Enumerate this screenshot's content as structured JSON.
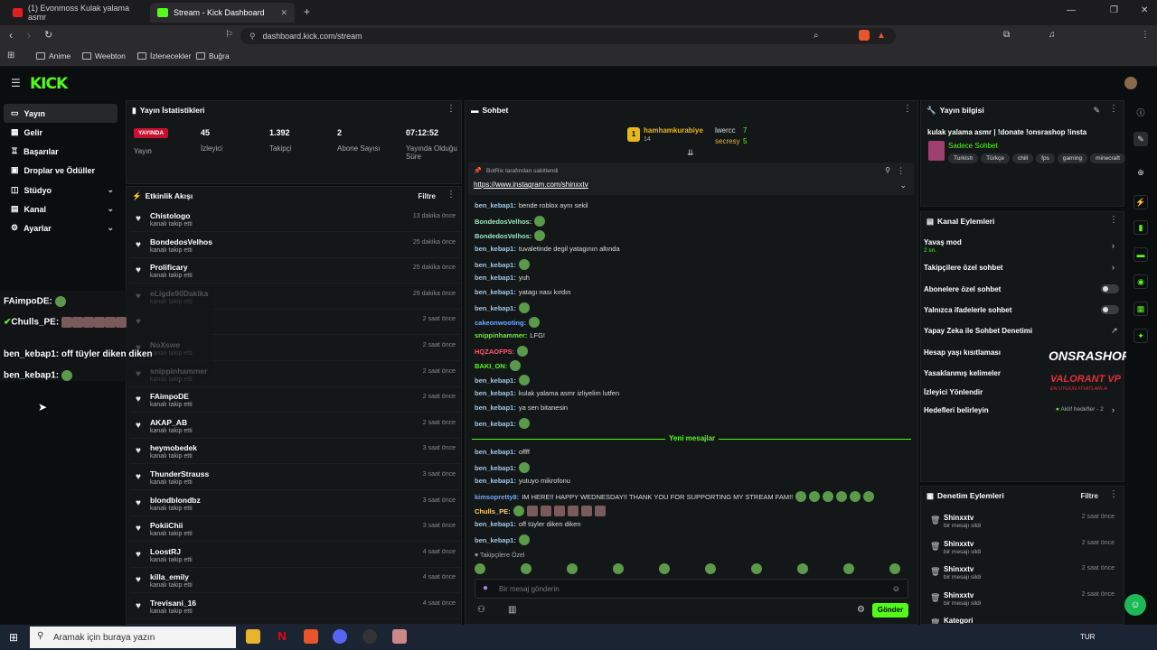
{
  "browser": {
    "tabs": [
      {
        "title": "(1) Evonmoss Kulak yalama asmr"
      },
      {
        "title": "Stream - Kick Dashboard"
      }
    ],
    "url": "dashboard.kick.com/stream",
    "bookmarks": [
      "Anime",
      "Weebton",
      "İzlenecekler",
      "Buğra"
    ]
  },
  "kick": {
    "logo": "KICK"
  },
  "sidebar": {
    "items": [
      {
        "label": "Yayın"
      },
      {
        "label": "Gelir"
      },
      {
        "label": "Başarılar"
      },
      {
        "label": "Droplar ve Ödüller"
      },
      {
        "label": "Stüdyo"
      },
      {
        "label": "Kanal"
      },
      {
        "label": "Ayarlar"
      }
    ]
  },
  "stats": {
    "title": "Yayın İstatistikleri",
    "live_badge": "YAYINDA",
    "live_label": "Yayın",
    "viewers": "45",
    "viewers_label": "İzleyici",
    "followers": "1.392",
    "followers_label": "Takipçi",
    "subs": "2",
    "subs_label": "Abone Sayısı",
    "uptime": "07:12:52",
    "uptime_label": "Yayında Olduğu Süre"
  },
  "activity": {
    "title": "Etkinlik Akışı",
    "filter": "Filtre",
    "events": [
      {
        "name": "Chistologo",
        "sub": "kanalı takip etti",
        "time": "13 dakika önce"
      },
      {
        "name": "BondedosVelhos",
        "sub": "kanalı takip etti",
        "time": "25 dakika önce"
      },
      {
        "name": "Prolificary",
        "sub": "kanalı takip etti",
        "time": "25 dakika önce"
      },
      {
        "name": "eLigde90Dakika",
        "sub": "kanalı takip etti",
        "time": "29 dakika önce"
      },
      {
        "name": "",
        "sub": "",
        "time": "2 saat önce"
      },
      {
        "name": "NoXswe",
        "sub": "kanalı takip etti",
        "time": "2 saat önce"
      },
      {
        "name": "snippinhammer",
        "sub": "kanalı takip etti",
        "time": "2 saat önce"
      },
      {
        "name": "FAimpoDE",
        "sub": "kanalı takip etti",
        "time": "2 saat önce"
      },
      {
        "name": "AKAP_AB",
        "sub": "kanalı takip etti",
        "time": "2 saat önce"
      },
      {
        "name": "heymobedek",
        "sub": "kanalı takip etti",
        "time": "3 saat önce"
      },
      {
        "name": "ThunderStrauss",
        "sub": "kanalı takip etti",
        "time": "3 saat önce"
      },
      {
        "name": "blondblondbz",
        "sub": "kanalı takip etti",
        "time": "3 saat önce"
      },
      {
        "name": "PokiiChii",
        "sub": "kanalı takip etti",
        "time": "3 saat önce"
      },
      {
        "name": "LoostRJ",
        "sub": "kanalı takip etti",
        "time": "4 saat önce"
      },
      {
        "name": "killa_emily",
        "sub": "kanalı takip etti",
        "time": "4 saat önce"
      },
      {
        "name": "Trevisani_16",
        "sub": "kanalı takip etti",
        "time": "4 saat önce"
      }
    ]
  },
  "overlay": {
    "lines": [
      {
        "user": "FAimpoDE:",
        "text": ""
      },
      {
        "user": "Chulls_PE:",
        "text": ""
      },
      {
        "user": "ben_kebap1:",
        "text": "off tüyler diken diken"
      },
      {
        "user": "ben_kebap1:",
        "text": ""
      }
    ]
  },
  "chat": {
    "title": "Sohbet",
    "top": [
      {
        "user": "hamhamkurabiye",
        "count": "14"
      },
      {
        "user": "lwercc",
        "count": "7"
      },
      {
        "user": "secresy",
        "count": "5"
      }
    ],
    "pinned_by": "BotRix tarafından sabitlendi",
    "pinned_link": "https://www.instagram.com/shinxxtv",
    "messages": [
      {
        "user": "ben_kebap1:",
        "text": "bende roblox aynı sekil"
      },
      {
        "user": "BondedosVelhos:",
        "text": ""
      },
      {
        "user": "BondedosVelhos:",
        "text": ""
      },
      {
        "user": "ben_kebap1:",
        "text": "tuvaletinde degil yatagının altında"
      },
      {
        "user": "ben_kebap1:",
        "text": ""
      },
      {
        "user": "ben_kebap1:",
        "text": "yuh"
      },
      {
        "user": "ben_kebap1:",
        "text": "yatagı nası kırdın"
      },
      {
        "user": "ben_kebap1:",
        "text": ""
      },
      {
        "user": "cakeonwooting:",
        "text": ""
      },
      {
        "user": "snippinhammer:",
        "text": "LFG!"
      },
      {
        "user": "HQZAOFPS:",
        "text": ""
      },
      {
        "user": "BAKI_ON:",
        "text": ""
      },
      {
        "user": "ben_kebap1:",
        "text": ""
      },
      {
        "user": "ben_kebap1:",
        "text": "kulak yalama asmr izliyelim lutfen"
      },
      {
        "user": "ben_kebap1:",
        "text": "ya sen bitanesin"
      },
      {
        "user": "ben_kebap1:",
        "text": ""
      }
    ],
    "new_messages": "Yeni mesajlar",
    "messages2": [
      {
        "user": "ben_kebap1:",
        "text": "offff"
      },
      {
        "user": "ben_kebap1:",
        "text": ""
      },
      {
        "user": "ben_kebap1:",
        "text": "yutuyo mikrofonu"
      },
      {
        "user": "kimsopretty8:",
        "text": "IM HERE!! HAPPY WEDNESDAY!! THANK YOU FOR SUPPORTING MY STREAM FAM!!"
      },
      {
        "user": "Chulls_PE:",
        "text": ""
      },
      {
        "user": "ben_kebap1:",
        "text": "off tüyler diken diken"
      },
      {
        "user": "ben_kebap1:",
        "text": ""
      }
    ],
    "followers_only": "Takipçilere Özel",
    "input_placeholder": "Bir mesaj gönderin",
    "send": "Gönder"
  },
  "info": {
    "title": "Yayın bilgisi",
    "stream_title": "kulak yalama asmr | !donate !onsrashop !insta",
    "category": "Sadece Sohbet",
    "tags": [
      "Turkish",
      "Türkçe",
      "chill",
      "fps",
      "gaming",
      "minecraft"
    ]
  },
  "channel": {
    "title": "Kanal Eylemleri",
    "slow_mode": "Yavaş mod",
    "slow_value": "2 sn.",
    "items": [
      "Takipçilere özel sohbet",
      "Abonelere özel sohbet",
      "Yalnızca ifadelerle sohbet",
      "Yapay Zeka ile Sohbet Denetimi",
      "Hesap yaşı kısıtlaması",
      "Yasaklanmış kelimeler",
      "İzleyici Yönlendir",
      "Hedefleri belirleyin"
    ],
    "goals_status": "Aktif hedefler - 2"
  },
  "ad": {
    "brand": "ONSRASHOP.COM",
    "line1": "VALORANT VP",
    "line2": "EN UYGUN FİYATLARLA"
  },
  "moderation": {
    "title": "Denetim Eylemleri",
    "filter": "Filtre",
    "rows": [
      {
        "user": "Shinxxtv",
        "action": "bir mesajı sildi",
        "time": "2 saat önce"
      },
      {
        "user": "Shinxxtv",
        "action": "bir mesajı sildi",
        "time": "2 saat önce"
      },
      {
        "user": "Shinxxtv",
        "action": "bir mesajı sildi",
        "time": "2 saat önce"
      },
      {
        "user": "Shinxxtv",
        "action": "bir mesajı sildi",
        "time": "2 saat önce"
      },
      {
        "user": "Kategori",
        "action": "",
        "time": ""
      }
    ]
  },
  "taskbar": {
    "search": "Aramak için buraya yazın",
    "lang": "TUR"
  }
}
